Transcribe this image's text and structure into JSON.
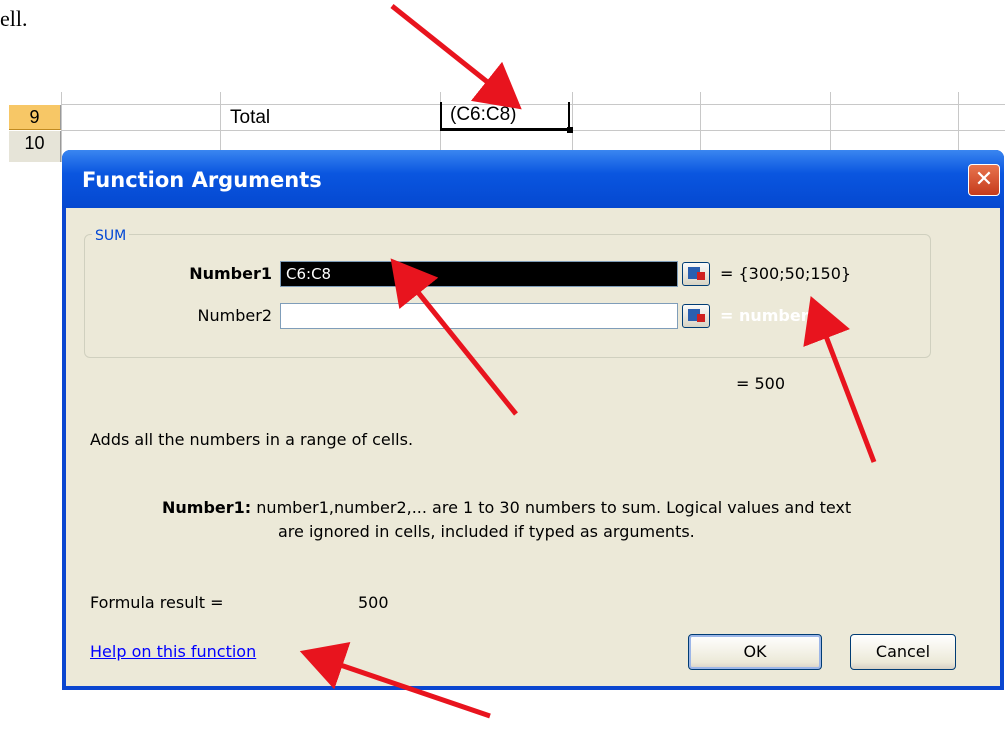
{
  "doc": {
    "snippet": "ell."
  },
  "sheet": {
    "row9": "9",
    "row10": "10",
    "cell_label": "Total",
    "active_cell_value": "(C6:C8)"
  },
  "dialog": {
    "title": "Function Arguments",
    "close_glyph": "✕",
    "function_name": "SUM",
    "args": [
      {
        "label": "Number1",
        "value": "C6:C8",
        "result": "= {300;50;150}"
      },
      {
        "label": "Number2",
        "value": "",
        "result": "= number"
      }
    ],
    "total_result": "= 500",
    "description": "Adds all the numbers in a range of cells.",
    "help_detail_label": "Number1:",
    "help_detail_line1": "number1,number2,... are 1 to 30 numbers to sum. Logical values and text",
    "help_detail_line2": "are ignored in cells, included if typed as arguments.",
    "formula_result_label": "Formula result =",
    "formula_result_value": "500",
    "help_link": "Help on this function",
    "ok_label": "OK",
    "cancel_label": "Cancel"
  },
  "colors": {
    "arrow": "#e8141e",
    "title_bar": "#0a56e0",
    "dialog_face": "#ece9d8"
  },
  "icons": {
    "ref_button": "collapse-dialog-icon"
  }
}
